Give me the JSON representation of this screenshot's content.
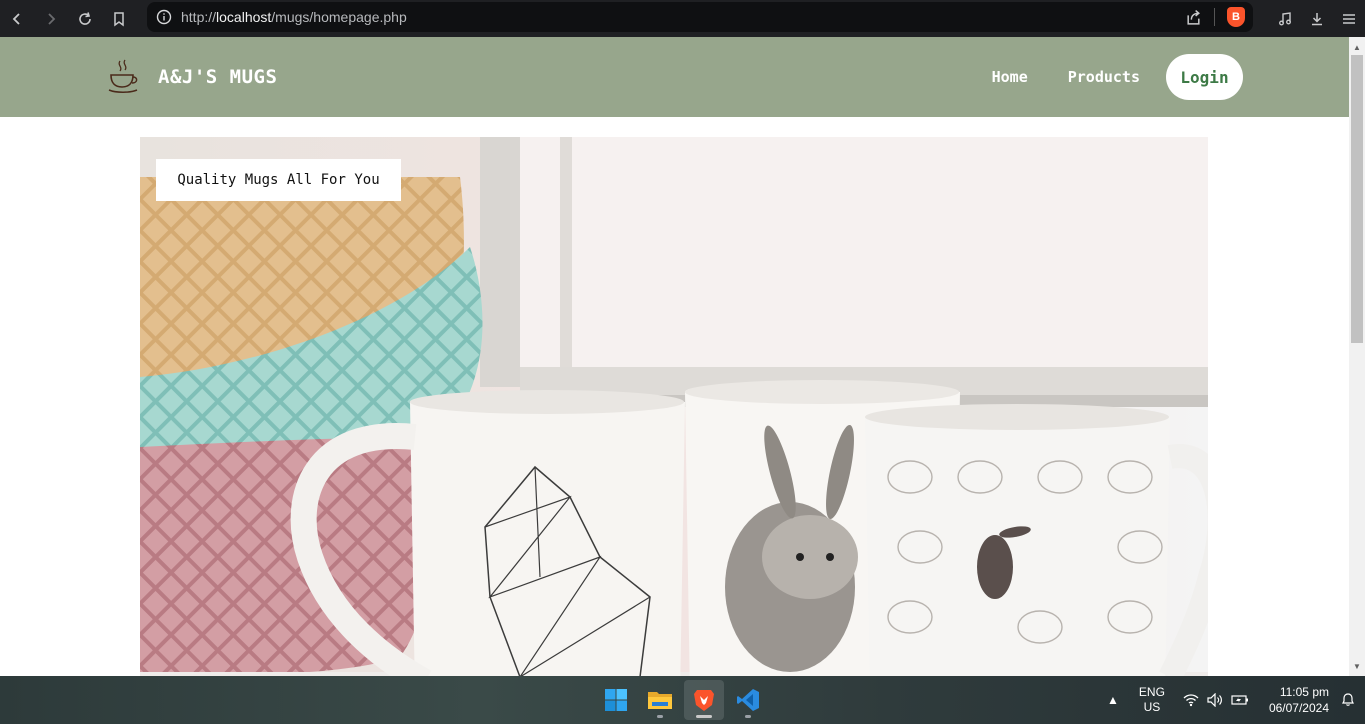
{
  "browser": {
    "url_prefix": "http://",
    "url_host": "localhost",
    "url_path": "/mugs/homepage.php",
    "brave_badge": "B"
  },
  "site": {
    "brand_name": "A&J'S MUGS",
    "nav": {
      "home": "Home",
      "products": "Products",
      "login": "Login"
    },
    "hero_tagline": "Quality Mugs All For You"
  },
  "taskbar": {
    "apps": [
      "windows-start-icon",
      "file-explorer-icon",
      "brave-browser-icon",
      "vscode-icon"
    ],
    "lang_line1": "ENG",
    "lang_line2": "US",
    "time": "11:05 pm",
    "date": "06/07/2024"
  },
  "colors": {
    "header_bg": "#97a68c",
    "login_text": "#3d7a46",
    "chrome_bg": "#1f2023"
  }
}
